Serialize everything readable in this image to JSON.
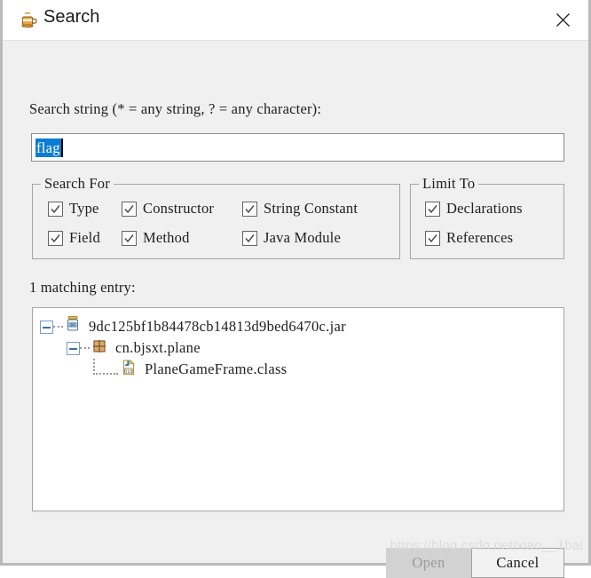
{
  "window": {
    "title": "Search",
    "icon": "java-coffee-cup-icon",
    "close_label": "✕"
  },
  "search": {
    "label": "Search string (* = any string, ? = any character):",
    "value": "flag"
  },
  "search_for": {
    "title": "Search For",
    "items": [
      {
        "label": "Type",
        "checked": true
      },
      {
        "label": "Constructor",
        "checked": true
      },
      {
        "label": "String Constant",
        "checked": true
      },
      {
        "label": "Field",
        "checked": true
      },
      {
        "label": "Method",
        "checked": true
      },
      {
        "label": "Java Module",
        "checked": true
      }
    ]
  },
  "limit_to": {
    "title": "Limit To",
    "items": [
      {
        "label": "Declarations",
        "checked": true
      },
      {
        "label": "References",
        "checked": true
      }
    ]
  },
  "results": {
    "count_label": "1 matching entry:",
    "tree": [
      {
        "label": "9dc125bf1b84478cb14813d9bed6470c.jar",
        "icon": "jar-file-icon",
        "expanded": true
      },
      {
        "label": "cn.bjsxt.plane",
        "icon": "package-icon",
        "expanded": true
      },
      {
        "label": "PlaneGameFrame.class",
        "icon": "class-file-icon",
        "expanded": false
      }
    ]
  },
  "buttons": {
    "open": "Open",
    "cancel": "Cancel"
  },
  "watermark": "https://blog.csdn.net/xiao__1bai",
  "colors": {
    "selection": "#0b7cd4",
    "dialog_bg": "#f0f0f0",
    "titlebar_bg": "#ffffff",
    "border": "#a4a4a4"
  }
}
